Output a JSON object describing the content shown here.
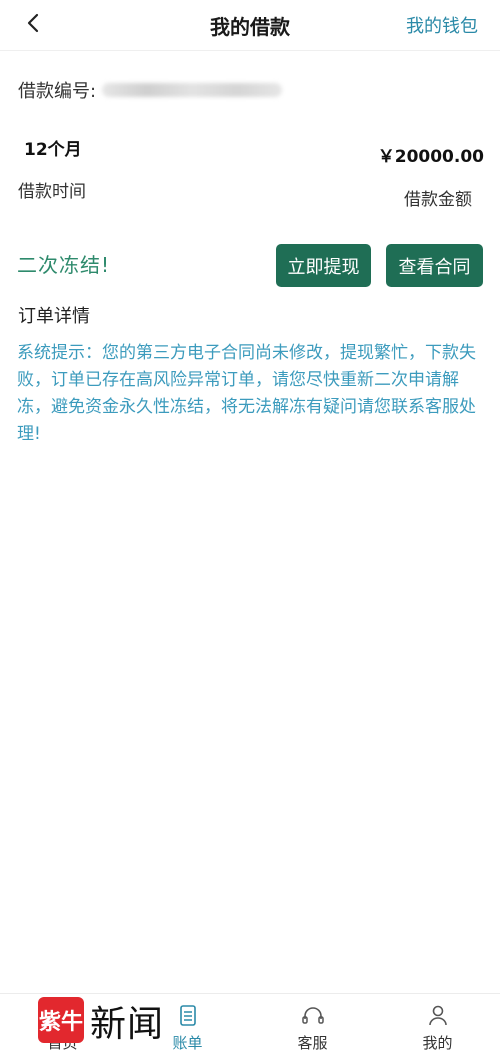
{
  "header": {
    "title": "我的借款",
    "wallet_link": "我的钱包"
  },
  "loan": {
    "number_label": "借款编号:",
    "term_value": "12个月",
    "term_label": "借款时间",
    "amount_value": "￥20000.00",
    "amount_label": "借款金额"
  },
  "status": {
    "freeze_text": "二次冻结!",
    "withdraw_button": "立即提现",
    "contract_button": "查看合同"
  },
  "order": {
    "title": "订单详情",
    "notice": "系统提示：您的第三方电子合同尚未修改，提现繁忙，下款失败，订单已存在高风险异常订单，请您尽快重新二次申请解冻，避免资金永久性冻结，将无法解冻有疑问请您联系客服处理!"
  },
  "tabbar": {
    "items": [
      {
        "label": "首页",
        "icon": "home-icon"
      },
      {
        "label": "账单",
        "icon": "bill-icon",
        "active": true
      },
      {
        "label": "客服",
        "icon": "headset-icon"
      },
      {
        "label": "我的",
        "icon": "user-icon"
      }
    ]
  },
  "watermark": {
    "logo_text": "紫牛",
    "text": "新闻"
  },
  "colors": {
    "accent": "#2b8aa8",
    "button": "#1f6e55",
    "status": "#2e8a6c",
    "notice": "#3c9bbd"
  }
}
